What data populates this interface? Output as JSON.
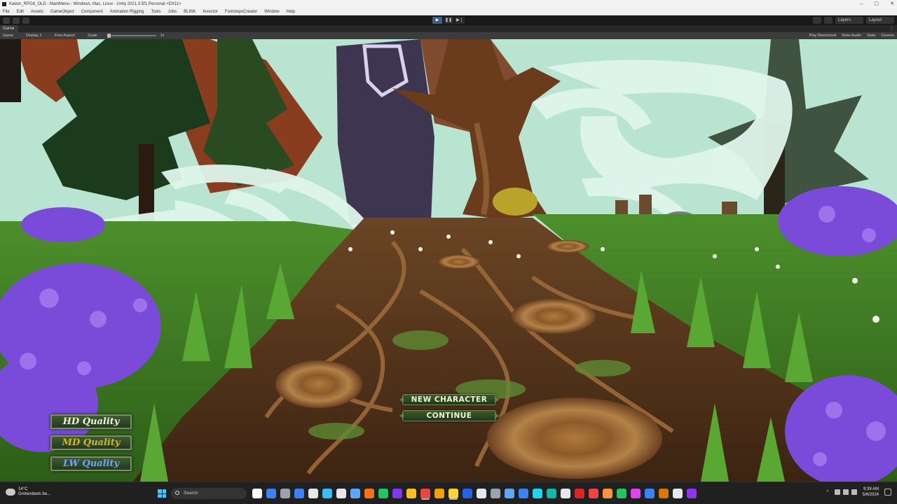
{
  "window": {
    "title": "Kadun_RPG8_OLD - MainMenu - Windows, Mac, Linux - Unity 2021.3.5f1 Personal <DX11>",
    "controls": [
      "–",
      "▢",
      "✕"
    ]
  },
  "menubar": {
    "items": [
      "File",
      "Edit",
      "Assets",
      "GameObject",
      "Component",
      "Animation Rigging",
      "Tools",
      "Jobs",
      "BLINK",
      "Invector",
      "FootstepsCreator",
      "Window",
      "Help"
    ]
  },
  "toolbar": {
    "layers_label": "Layers",
    "layout_label": "Layout",
    "play_icon": "▶",
    "pause_icon": "❚❚",
    "step_icon": "▶❘"
  },
  "game_tab": {
    "label": "Game",
    "kebab": "⋮"
  },
  "game_bar": {
    "mode": "Game",
    "display": "Display 1",
    "aspect": "Free Aspect",
    "scale_label": "Scale",
    "scale_value": "1x",
    "play_mode": "Play Maximized",
    "mute_audio": "Mute Audio",
    "stats": "Stats",
    "gizmos": "Gizmos"
  },
  "game_menu": {
    "new_character": "NEW CHARACTER",
    "continue": "CONTINUE",
    "hd_quality": "HD Quality",
    "md_quality": "MD Quality",
    "lw_quality": "LW Quality"
  },
  "taskbar": {
    "weather_temp": "14°C",
    "weather_desc": "Grotendeels be...",
    "search_placeholder": "Search",
    "time": "9:39 AM",
    "date": "5/6/2024",
    "app_colors": [
      "#ffffff",
      "#3b82f6",
      "#9ca3af",
      "#3b82f6",
      "#e5e7eb",
      "#38bdf8",
      "#e5e7eb",
      "#60a5fa",
      "#f97316",
      "#22c55e",
      "#7c3aed",
      "#fbbf24",
      "#ef4444",
      "#f59e0b",
      "#ffd43b",
      "#2563eb",
      "#e5e7eb",
      "#9ca3af",
      "#60a5fa",
      "#3b82f6",
      "#22d3ee",
      "#14b8a6",
      "#e5e7eb",
      "#dc2626",
      "#ef4444",
      "#fb923c",
      "#22c55e",
      "#d946ef",
      "#3b82f6",
      "#d97706",
      "#e5e7eb",
      "#9333ea"
    ]
  },
  "colors": {
    "sky": "#b7e3d0",
    "grass": "#3f7d22",
    "path": "#5a3a1e",
    "accent_blue": "#4cc2ff"
  }
}
